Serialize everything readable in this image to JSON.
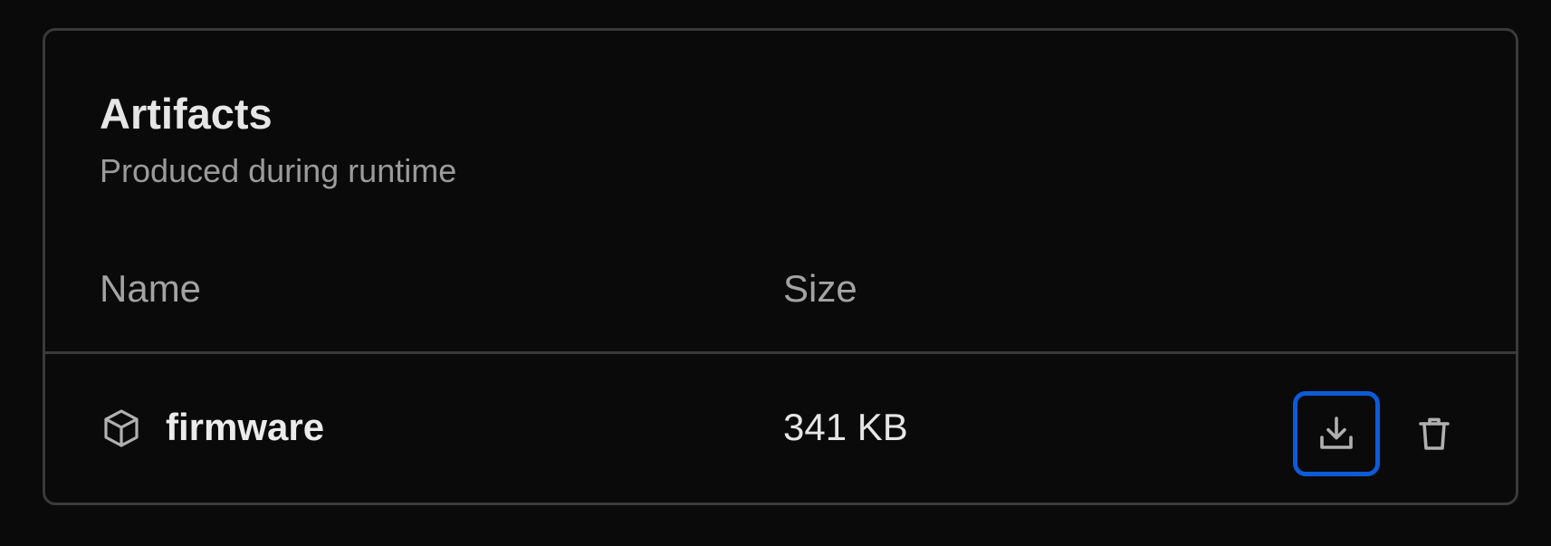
{
  "card": {
    "title": "Artifacts",
    "subtitle": "Produced during runtime"
  },
  "table": {
    "columns": [
      "Name",
      "Size"
    ],
    "rows": [
      {
        "icon": "package-icon",
        "name": "firmware",
        "size": "341 KB",
        "actions": [
          "download-icon",
          "trash-icon"
        ]
      }
    ]
  },
  "colors": {
    "background": "#0a0a0a",
    "border": "#3a3a3a",
    "focus_ring": "#0d5bd7",
    "icon": "#b0b0b0"
  }
}
